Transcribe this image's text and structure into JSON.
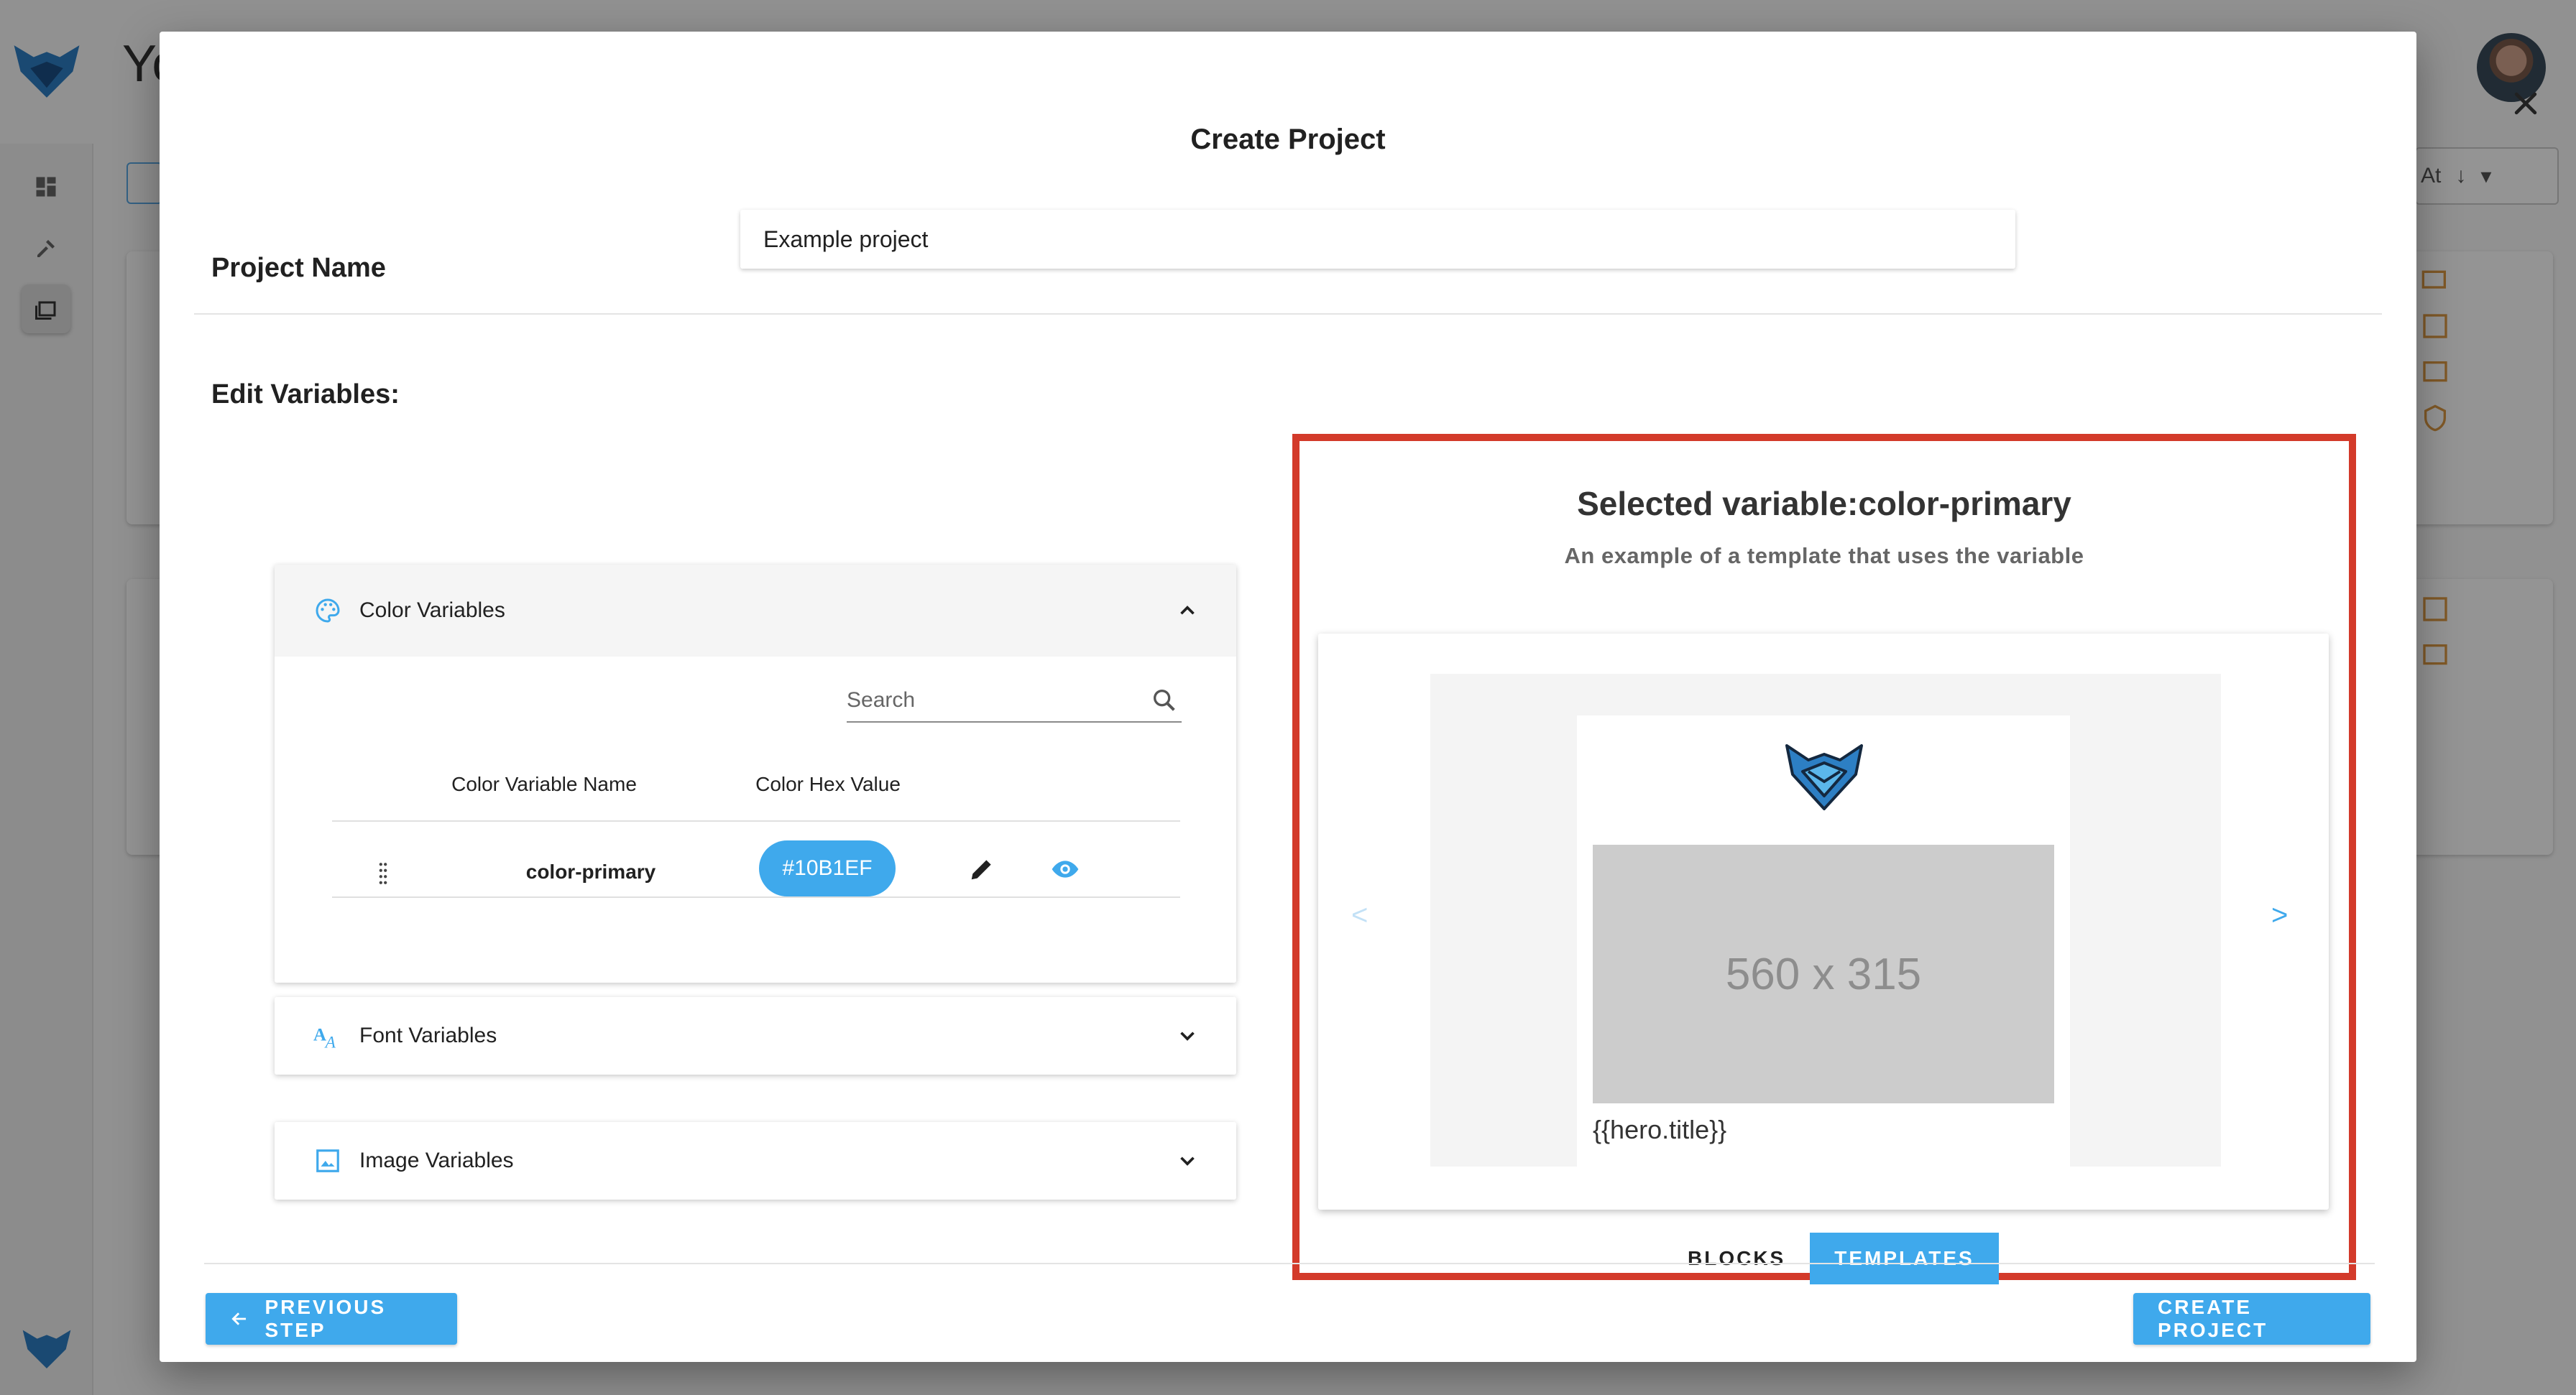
{
  "background": {
    "title_fragment": "Yo",
    "sort_label": "At"
  },
  "modal": {
    "title": "Create Project",
    "project_name_label": "Project Name",
    "project_name_value": "Example project",
    "edit_variables_label": "Edit Variables:"
  },
  "panels": {
    "color": {
      "label": "Color Variables",
      "search_placeholder": "Search",
      "columns": [
        "Color Variable Name",
        "Color Hex Value"
      ],
      "rows": [
        {
          "name": "color-primary",
          "hex": "#10B1EF"
        }
      ]
    },
    "font": {
      "label": "Font Variables"
    },
    "image": {
      "label": "Image Variables"
    }
  },
  "preview": {
    "title": "Selected variable:color-primary",
    "subtitle": "An example of a template that uses the variable",
    "prev_label": "<",
    "next_label": ">",
    "placeholder_size": "560 x 315",
    "template_text": "{{hero.title}}",
    "tabs": [
      {
        "label": "BLOCKS",
        "active": false
      },
      {
        "label": "TEMPLATES",
        "active": true
      }
    ]
  },
  "footer": {
    "previous_label": "PREVIOUS STEP",
    "create_label": "CREATE PROJECT"
  },
  "colors": {
    "accent": "#3FA9EC",
    "highlight_border": "#D33A2A",
    "logo_blue": "#2D7FC4"
  }
}
